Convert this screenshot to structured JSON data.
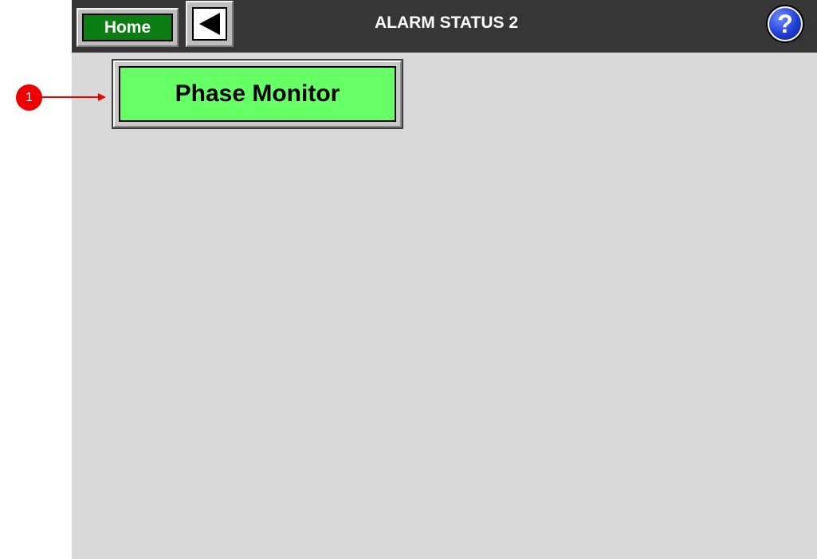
{
  "header": {
    "title": "ALARM STATUS 2",
    "home_label": "Home",
    "back_icon": "back-arrow-icon",
    "help_label": "?"
  },
  "main": {
    "phase_monitor_label": "Phase Monitor"
  },
  "annotation": {
    "callout_number": "1"
  },
  "colors": {
    "home_green": "#0b7d12",
    "phase_green": "#66ff66",
    "header_bg": "#363636",
    "panel_bg": "#d9d9d9",
    "callout_red": "#ee0000",
    "help_blue": "#1f3fd6"
  }
}
